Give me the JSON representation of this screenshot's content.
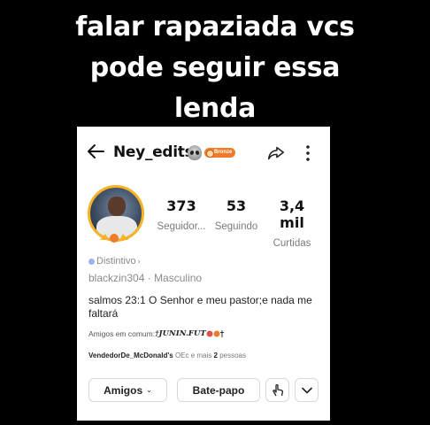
{
  "caption": {
    "line1": "falar rapaziada vcs",
    "line2": "pode seguir essa",
    "line3": "lenda"
  },
  "profile": {
    "username": "Ney_edits",
    "badge": "Bronze",
    "stats": [
      {
        "value": "373",
        "label": "Seguidor..."
      },
      {
        "value": "53",
        "label": "Seguindo"
      },
      {
        "value": "3,4 mil",
        "label": "Curtidas"
      }
    ],
    "distintivo": "Distintivo",
    "handle": "blackzin304",
    "gender": "Masculino",
    "bio": "salmos 23:1 O Senhor e meu pastor;e nada me faltará",
    "mutual_prefix": "Amigos em comum:",
    "mutual_name": "†JUNIN.FUT",
    "followers_prefix": "VendedorDe_McDonald's",
    "followers_mid": "OEc e mais",
    "followers_count": "2",
    "followers_suffix": "pessoas"
  },
  "buttons": {
    "friends": "Amigos",
    "chat": "Bate-papo"
  },
  "icons": [
    "back-arrow-icon",
    "alien-icon",
    "share-icon",
    "more-vertical-icon",
    "hand-touch-icon",
    "chevron-down-icon"
  ],
  "colors": {
    "badge": "#f07c2a",
    "avatar_ring": "#f5b325",
    "distintivo_dot": "#9fb3f0"
  }
}
